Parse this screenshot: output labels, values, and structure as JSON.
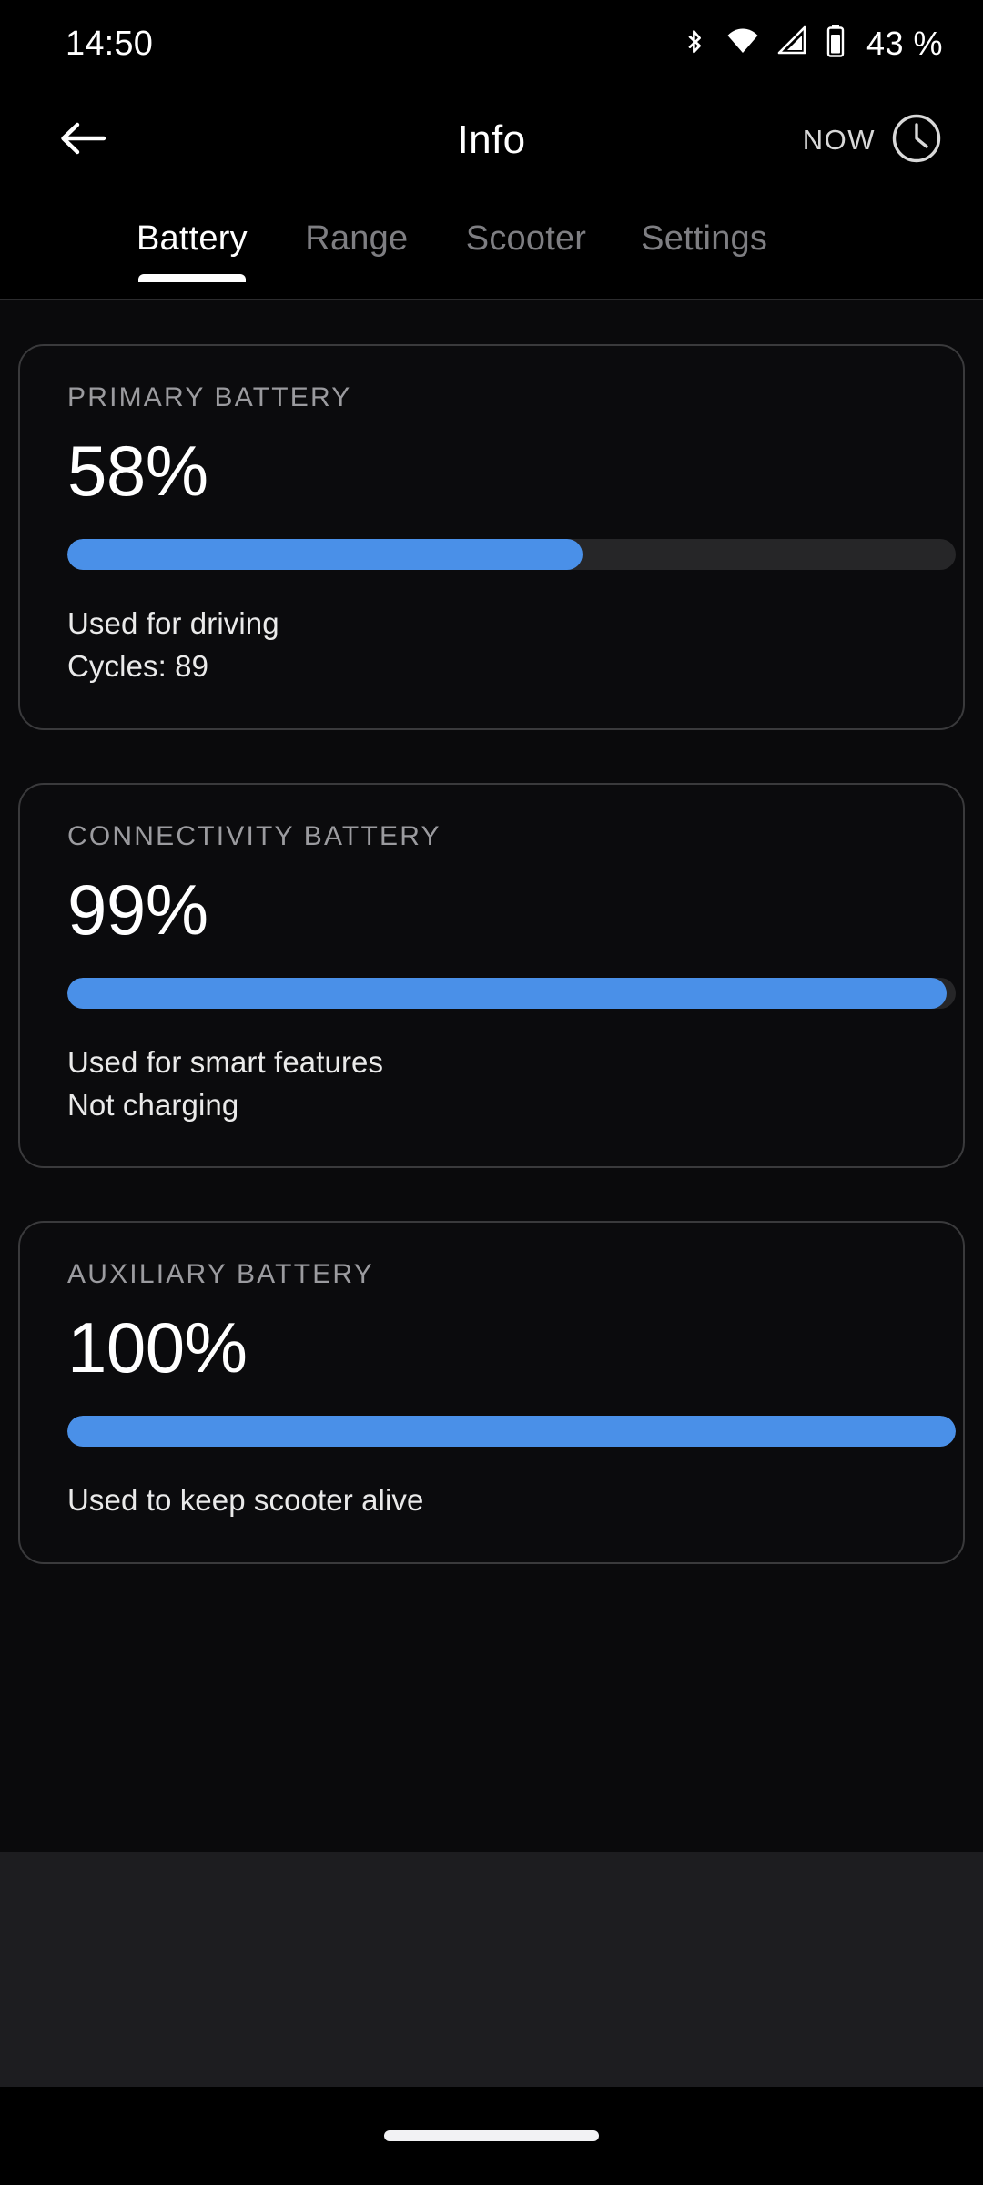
{
  "status_bar": {
    "time": "14:50",
    "battery_percent": "43 %",
    "icons": [
      "bluetooth-icon",
      "wifi-icon",
      "cellular-signal-icon",
      "battery-icon"
    ]
  },
  "app_bar": {
    "back_icon": "back-arrow-icon",
    "title": "Info",
    "now_label": "NOW",
    "clock_icon": "clock-icon"
  },
  "tabs": [
    {
      "label": "Battery",
      "active": true
    },
    {
      "label": "Range",
      "active": false
    },
    {
      "label": "Scooter",
      "active": false
    },
    {
      "label": "Settings",
      "active": false
    }
  ],
  "colors": {
    "accent_blue": "#4a90e8",
    "track_gray": "#262628",
    "card_border": "#3a3a3c",
    "background": "#000000",
    "muted_text": "#9b9b9f"
  },
  "cards": [
    {
      "label": "PRIMARY BATTERY",
      "value": "58%",
      "percent": 58,
      "note_1": "Used for driving",
      "note_2": "Cycles: 89"
    },
    {
      "label": "CONNECTIVITY BATTERY",
      "value": "99%",
      "percent": 99,
      "note_1": "Used for smart features",
      "note_2": "Not charging"
    },
    {
      "label": "AUXILIARY BATTERY",
      "value": "100%",
      "percent": 100,
      "note_1": "Used to keep scooter alive",
      "note_2": ""
    }
  ],
  "nav_bar": {
    "gesture_pill": "home-gesture-pill"
  }
}
